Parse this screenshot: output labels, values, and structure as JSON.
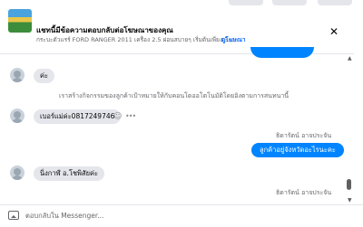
{
  "ad": {
    "title": "แชทนี้มีข้อความตอบกลับต่อโฆษณาของคุณ",
    "subtitle": "กระบะตัวแรร์ FORD RANGER 2011 เครื่อง 2.5 ผ่อนสบายๆ เริ่มต้นเพียง 3,...",
    "link_label": "ดูโฆษณา",
    "close_icon": "close-icon"
  },
  "messages": {
    "recv_1": "ค่ะ",
    "system_note": "เราสร้างกิจกรรมของลูกค้าเป้าหมายให้กับคอนโดออโตโนมัติโดยอิงตามการสนทนานี้",
    "recv_2": "เบอร์แม่ค่ะ0817249746",
    "sender_1": "ธิดารัตน์ อาจประจัน",
    "sent_1": "ลูกค้าอยู่จังหวัดอะไรนะคะ",
    "recv_3": "นิ่งกาฬ์ อ.โชพิสัยค่ะ",
    "sender_2": "ธิดารัตน์ อาจประจัน"
  },
  "composer": {
    "placeholder": "ตอบกลับใน Messenger..."
  },
  "icons": {
    "reaction": "smiley-icon",
    "more": "more-icon",
    "image": "image-icon"
  },
  "colors": {
    "sent_bubble": "#0084ff",
    "recv_bubble": "#e4e6eb",
    "link": "#0866ff"
  }
}
